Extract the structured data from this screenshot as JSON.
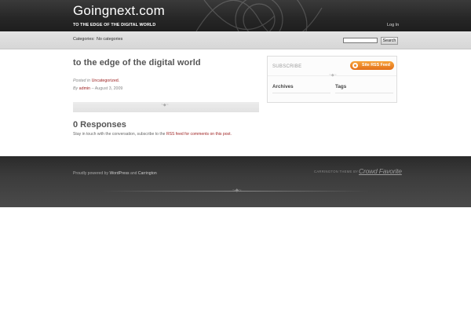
{
  "header": {
    "site_title": "Goingnext.com",
    "tagline": "TO THE EDGE OF THE DIGITAL WORLD",
    "login_label": "Log In"
  },
  "nav": {
    "categories_label": "Categories:",
    "categories_value": "No categories",
    "search_placeholder": "",
    "search_button_label": "Search"
  },
  "post": {
    "title": "to the edge of the digital world",
    "posted_in_label": "Posted in",
    "category": "Uncategorized.",
    "by_label": "By",
    "author": "admin",
    "date_separator": "–",
    "date": "August 3, 2009"
  },
  "responses": {
    "title": "0 Responses",
    "text_before": "Stay in touch with the conversation, subscribe to the",
    "rss_label": "RSS",
    "feed_link_label": "feed for comments on this post."
  },
  "sidebar": {
    "subscribe_label": "SUBSCRIBE",
    "rss_button_label": "Site RSS Feed",
    "archives_heading": "Archives",
    "tags_heading": "Tags"
  },
  "footer": {
    "powered_prefix": "Proudly powered by",
    "wordpress_label": "WordPress",
    "and_label": "and",
    "carrington_label": "Carrington",
    "theme_credit_label": "CARRINGTON THEME BY",
    "crowd_favorite_label": "Crowd Favorite"
  },
  "icons": {
    "rss": "rss-icon",
    "header_decoration": "swirl-ornament-icon",
    "divider_ornament": "ornament-icon"
  },
  "colors": {
    "header_bg": "#262626",
    "link": "#9b1c1c",
    "rss_orange": "#e2701a",
    "footer_bg": "#3c3c3c"
  }
}
